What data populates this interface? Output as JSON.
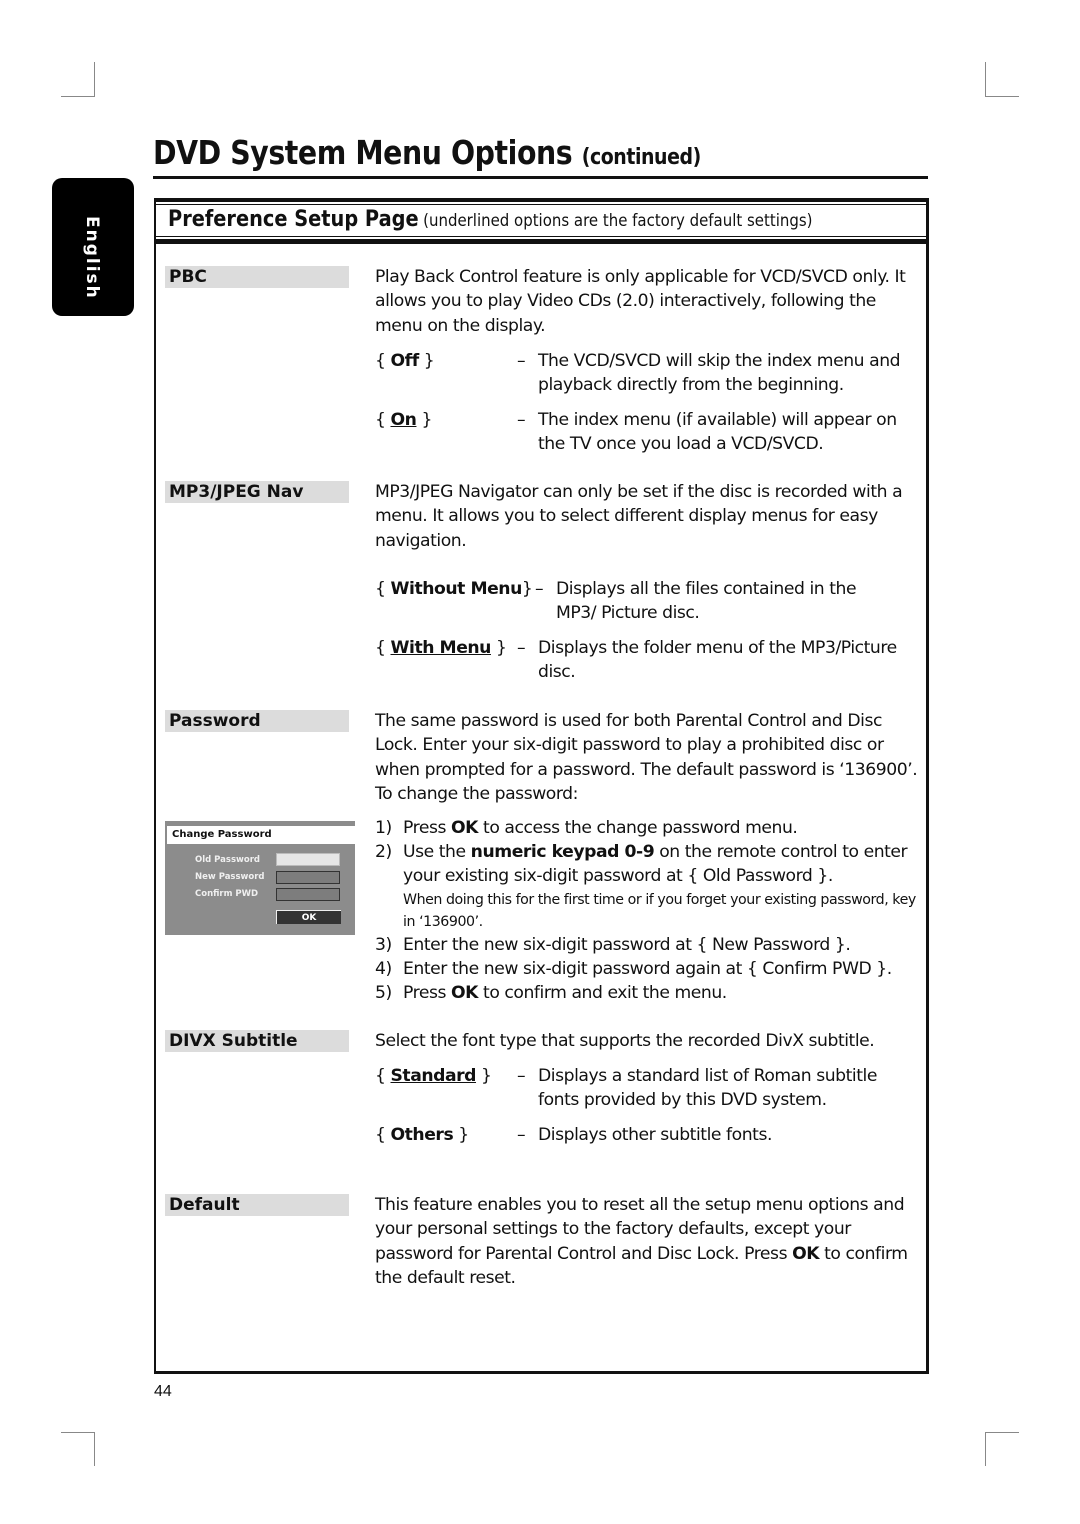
{
  "page": {
    "title": "DVD System Menu Options",
    "title_suffix": "(continued)",
    "language_tab": "English",
    "page_number": "44"
  },
  "section": {
    "title": "Preference Setup Page",
    "subtitle": "(underlined options are the factory default settings)"
  },
  "pbc": {
    "label": "PBC",
    "description": "Play Back Control feature is only applicable for VCD/SVCD only. It allows you to play Video CDs (2.0) interactively, following the menu on the display.",
    "options": [
      {
        "name": "Off",
        "default": false,
        "description": "The VCD/SVCD will skip the index menu and playback directly from the beginning."
      },
      {
        "name": "On",
        "default": true,
        "description": "The index menu (if available) will appear on the TV once you load a VCD/SVCD."
      }
    ]
  },
  "mp3nav": {
    "label": "MP3/JPEG Nav",
    "description": "MP3/JPEG Navigator can only be set if the disc is recorded with a menu.  It allows you to select different display menus for easy navigation.",
    "options": [
      {
        "name": "Without Menu",
        "default": false,
        "description": "Displays all the files contained in the MP3/ Picture disc."
      },
      {
        "name": "With Menu",
        "default": true,
        "description": "Displays the folder menu of the MP3/Picture disc."
      }
    ]
  },
  "password": {
    "label": "Password",
    "description": "The same password is used for both Parental Control and Disc Lock.  Enter your six-digit password to play a prohibited disc or when prompted for a password.  The default password is ‘136900’.  To change the password:",
    "dialog": {
      "title": "Change Password",
      "fields": [
        "Old Password",
        "New Password",
        "Confirm PWD"
      ],
      "ok_label": "OK"
    },
    "steps": [
      {
        "num": "1)",
        "pre": "Press ",
        "bold": "OK",
        "post": " to access the change password menu."
      },
      {
        "num": "2)",
        "pre": "Use the ",
        "bold": "numeric keypad 0-9",
        "post": " on the remote control to enter your existing six-digit password at { Old Password }.",
        "note": "When doing this for the first time or if you forget your existing password, key in ‘136900’."
      },
      {
        "num": "3)",
        "pre": "Enter the new six-digit password at { New Password }.",
        "bold": "",
        "post": ""
      },
      {
        "num": "4)",
        "pre": "Enter the new six-digit password again at { Confirm PWD }.",
        "bold": "",
        "post": ""
      },
      {
        "num": "5)",
        "pre": "Press ",
        "bold": "OK",
        "post": " to confirm and exit the menu."
      }
    ]
  },
  "divx": {
    "label": "DIVX Subtitle",
    "description": "Select the font type that supports the recorded DivX subtitle.",
    "options": [
      {
        "name": "Standard",
        "default": true,
        "description": "Displays a standard list of Roman subtitle fonts provided by this DVD system."
      },
      {
        "name": "Others",
        "default": false,
        "description": "Displays other subtitle fonts."
      }
    ]
  },
  "default": {
    "label": "Default",
    "description_pre": "This feature enables you to reset all the setup menu options and your personal settings to the factory defaults, except your password for Parental Control and Disc Lock.  Press ",
    "description_bold": "OK",
    "description_post": " to confirm the default reset."
  }
}
